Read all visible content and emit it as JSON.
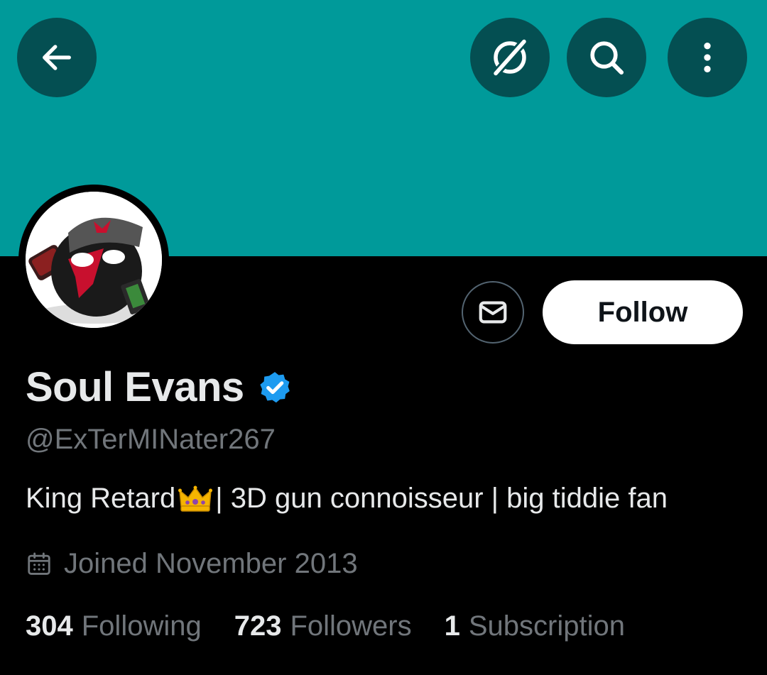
{
  "profile": {
    "display_name": "Soul Evans",
    "handle": "@ExTerMINater267",
    "bio_before_emoji": "King Retard",
    "bio_emoji_icon": "crown-icon",
    "bio_after_emoji": "| 3D gun connoisseur | big tiddie fan",
    "joined": "Joined November 2013",
    "verified": true
  },
  "actions": {
    "follow_label": "Follow",
    "message_icon": "envelope-icon"
  },
  "header": {
    "back_icon": "back-arrow-icon",
    "grok_icon": "grok-icon",
    "search_icon": "search-icon",
    "more_icon": "more-vertical-icon"
  },
  "stats": {
    "following_count": "304",
    "following_label": "Following",
    "followers_count": "723",
    "followers_label": "Followers",
    "subscriptions_count": "1",
    "subscriptions_label": "Subscription"
  },
  "colors": {
    "banner": "#009a9a",
    "header_button": "#044f52",
    "verified": "#1d9bf0",
    "secondary_text": "#71767b"
  }
}
